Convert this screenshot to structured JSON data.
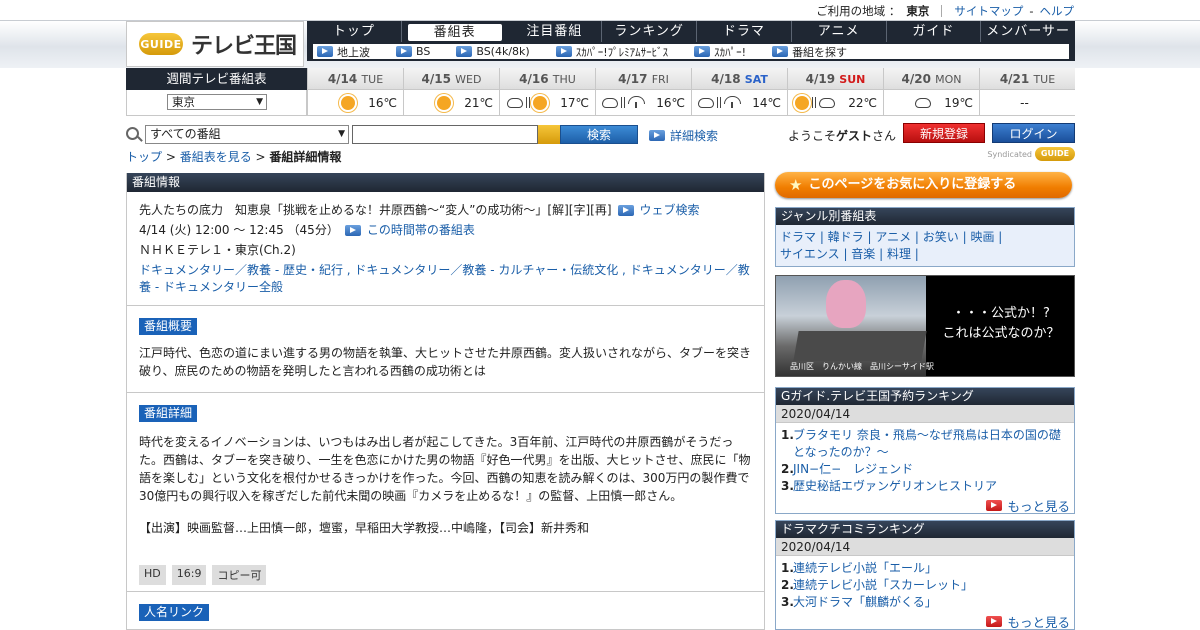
{
  "topbar": {
    "region_label": "ご利用の地域 ：",
    "region_value": "東京",
    "sitemap": "サイトマップ",
    "dash": "-",
    "help": "ヘルプ"
  },
  "logo": {
    "mark": "GUIDE",
    "name": "テレビ王国"
  },
  "nav": {
    "tabs": [
      "トップ",
      "番組表",
      "注目番組",
      "ランキング",
      "ドラマ",
      "アニメ",
      "ガイド",
      "メンバーサービス"
    ],
    "active_index": 1,
    "sub": [
      "地上波",
      "BS",
      "BS(4k/8k)",
      "ｽｶﾊﾟｰ!ﾌﾟﾚﾐｱﾑｻｰﾋﾞｽ",
      "ｽｶﾊﾟｰ!",
      "番組を探す"
    ]
  },
  "week": {
    "label": "週間テレビ番組表",
    "area": "東京",
    "days": [
      {
        "date": "4/14",
        "wd": "TUE",
        "kind": "",
        "icons": [
          "sun"
        ],
        "temp": "16℃"
      },
      {
        "date": "4/15",
        "wd": "WED",
        "kind": "",
        "icons": [
          "sun"
        ],
        "temp": "21℃"
      },
      {
        "date": "4/16",
        "wd": "THU",
        "kind": "",
        "icons": [
          "cloud",
          "bar",
          "sun"
        ],
        "temp": "17℃"
      },
      {
        "date": "4/17",
        "wd": "FRI",
        "kind": "",
        "icons": [
          "cloud",
          "bar",
          "umbrella"
        ],
        "temp": "16℃"
      },
      {
        "date": "4/18",
        "wd": "SAT",
        "kind": "sat",
        "icons": [
          "cloud",
          "bar",
          "umbrella"
        ],
        "temp": "14℃"
      },
      {
        "date": "4/19",
        "wd": "SUN",
        "kind": "sun",
        "icons": [
          "sun",
          "bar",
          "cloud"
        ],
        "temp": "22℃"
      },
      {
        "date": "4/20",
        "wd": "MON",
        "kind": "",
        "icons": [
          "cloud"
        ],
        "temp": "19℃"
      },
      {
        "date": "4/21",
        "wd": "TUE",
        "kind": "",
        "icons": [],
        "temp": "--"
      }
    ]
  },
  "search": {
    "category": "すべての番組",
    "button": "検索",
    "advanced": "詳細検索",
    "welcome_pre": "ようこそ",
    "welcome_name": "ゲスト",
    "welcome_post": "さん",
    "register": "新規登録",
    "login": "ログイン"
  },
  "crumb": {
    "top": "トップ",
    "sep": " > ",
    "list": "番組表を見る",
    "current": "番組詳細情報"
  },
  "syndicated": {
    "label": "Syndicated",
    "mark": "GUIDE"
  },
  "program": {
    "header": "番組情報",
    "title": "先人たちの底力　知恵泉「挑戦を止めるな！井原西鶴～“変人”の成功術～」[解][字][再]",
    "web_search": "ウェブ検索",
    "time": "4/14 (火) 12:00 ～ 12:45 （45分）",
    "time_link": "この時間帯の番組表",
    "channel": "ＮＨＫＥテレ１・東京(Ch.2)",
    "genres": "ドキュメンタリー／教養 - 歴史・紀行 , ドキュメンタリー／教養 - カルチャー・伝統文化 , ドキュメンタリー／教養 - ドキュメンタリー全般"
  },
  "summary": {
    "tag": "番組概要",
    "text": "江戸時代、色恋の道にまい進する男の物語を執筆、大ヒットさせた井原西鶴。変人扱いされながら、タブーを突き破り、庶民のための物語を発明したと言われる西鶴の成功術とは"
  },
  "detail": {
    "tag": "番組詳細",
    "text": "時代を変えるイノベーションは、いつもはみ出し者が起こしてきた。3百年前、江戸時代の井原西鶴がそうだった。西鶴は、タブーを突き破り、一生を色恋にかけた男の物語『好色一代男』を出版、大ヒットさせ、庶民に「物語を楽しむ」という文化を根付かせるきっかけを作った。今回、西鶴の知恵を読み解くのは、300万円の製作費で30億円もの興行収入を稼ぎだした前代未聞の映画『カメラを止めるな！』の監督、上田慎一郎さん。",
    "cast": "【出演】映画監督…上田慎一郎，壇蜜，早稲田大学教授…中嶋隆，【司会】新井秀和",
    "badges": [
      "HD",
      "16:9",
      "コピー可"
    ]
  },
  "people": {
    "tag": "人名リンク"
  },
  "side": {
    "favorite": "このページをお気に入りに登録する",
    "genre_header": "ジャンル別番組表",
    "genre_line1": "ドラマ | 韓ドラ | アニメ | お笑い | 映画 |",
    "genre_line2": "サイエンス | 音楽 | 料理 |",
    "banner_line1": "・・・公式か！?",
    "banner_line2": "これは公式なのか？",
    "banner_caption": "品川区　りんかい線　品川シーサイド駅",
    "rank1": {
      "header": "Gガイド.テレビ王国予約ランキング",
      "date": "2020/04/14",
      "items": [
        "ブラタモリ 奈良・飛鳥〜なぜ飛鳥は日本の国の礎となったのか？〜",
        "JIN−仁−　レジェンド",
        "歴史秘話エヴァンゲリオンヒストリア"
      ],
      "more": "もっと見る"
    },
    "rank2": {
      "header": "ドラマクチコミランキング",
      "date": "2020/04/14",
      "items": [
        "連続テレビ小説「エール」",
        "連続テレビ小説「スカーレット」",
        "大河ドラマ「麒麟がくる」"
      ],
      "more": "もっと見る"
    }
  }
}
